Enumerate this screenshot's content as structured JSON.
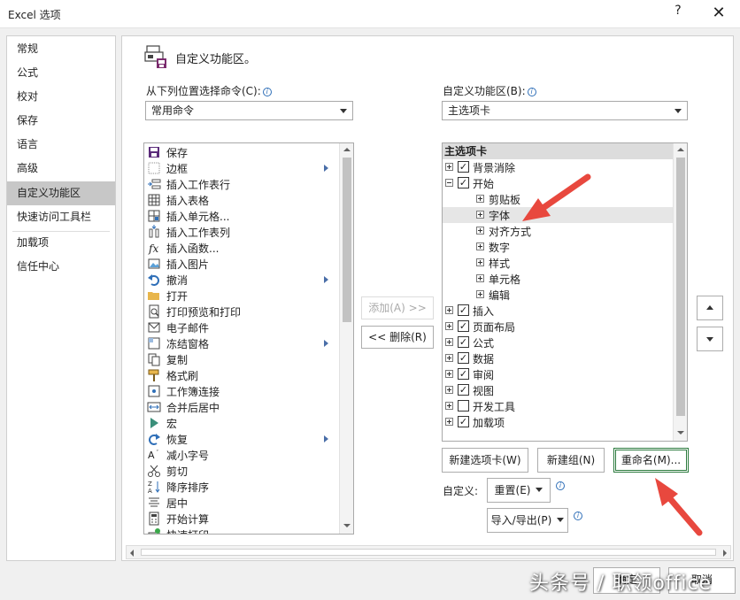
{
  "window": {
    "title": "Excel 选项",
    "help_glyph": "?",
    "close_glyph": "✕"
  },
  "nav": {
    "items": [
      {
        "label": "常规"
      },
      {
        "label": "公式"
      },
      {
        "label": "校对"
      },
      {
        "label": "保存"
      },
      {
        "label": "语言"
      },
      {
        "label": "高级"
      },
      {
        "label": "自定义功能区",
        "selected": true
      },
      {
        "label": "快速访问工具栏"
      },
      {
        "label": "加载项"
      },
      {
        "label": "信任中心"
      }
    ]
  },
  "header": {
    "title": "自定义功能区。"
  },
  "commands": {
    "label": "从下列位置选择命令(C):",
    "source_selected": "常用命令",
    "items": [
      {
        "label": "保存",
        "icon": "save-icon"
      },
      {
        "label": "边框",
        "icon": "border-icon",
        "submenu": true
      },
      {
        "label": "插入工作表行",
        "icon": "insert-row-icon"
      },
      {
        "label": "插入表格",
        "icon": "insert-table-icon"
      },
      {
        "label": "插入单元格...",
        "icon": "insert-cells-icon"
      },
      {
        "label": "插入工作表列",
        "icon": "insert-column-icon"
      },
      {
        "label": "插入函数...",
        "icon": "function-icon"
      },
      {
        "label": "插入图片",
        "icon": "picture-icon"
      },
      {
        "label": "撤消",
        "icon": "undo-icon",
        "submenu": true
      },
      {
        "label": "打开",
        "icon": "open-folder-icon"
      },
      {
        "label": "打印预览和打印",
        "icon": "print-preview-icon"
      },
      {
        "label": "电子邮件",
        "icon": "email-icon"
      },
      {
        "label": "冻结窗格",
        "icon": "freeze-panes-icon",
        "submenu": true
      },
      {
        "label": "复制",
        "icon": "copy-icon"
      },
      {
        "label": "格式刷",
        "icon": "format-painter-icon"
      },
      {
        "label": "工作簿连接",
        "icon": "connections-icon"
      },
      {
        "label": "合并后居中",
        "icon": "merge-center-icon"
      },
      {
        "label": "宏",
        "icon": "macro-icon"
      },
      {
        "label": "恢复",
        "icon": "redo-icon",
        "submenu": true
      },
      {
        "label": "减小字号",
        "icon": "decrease-font-icon"
      },
      {
        "label": "剪切",
        "icon": "cut-icon"
      },
      {
        "label": "降序排序",
        "icon": "sort-descending-icon"
      },
      {
        "label": "居中",
        "icon": "align-center-icon"
      },
      {
        "label": "开始计算",
        "icon": "calculate-icon"
      },
      {
        "label": "快速打印",
        "icon": "quick-print-icon"
      }
    ]
  },
  "ribbon": {
    "label": "自定义功能区(B):",
    "target_selected": "主选项卡",
    "tree_header": "主选项卡",
    "items": [
      {
        "label": "背景消除",
        "level": 0,
        "expander": "plus",
        "checked": true
      },
      {
        "label": "开始",
        "level": 0,
        "expander": "minus",
        "checked": true
      },
      {
        "label": "剪贴板",
        "level": 1,
        "expander": "plus"
      },
      {
        "label": "字体",
        "level": 1,
        "expander": "plus",
        "selected": true
      },
      {
        "label": "对齐方式",
        "level": 1,
        "expander": "plus"
      },
      {
        "label": "数字",
        "level": 1,
        "expander": "plus"
      },
      {
        "label": "样式",
        "level": 1,
        "expander": "plus"
      },
      {
        "label": "单元格",
        "level": 1,
        "expander": "plus"
      },
      {
        "label": "编辑",
        "level": 1,
        "expander": "plus"
      },
      {
        "label": "插入",
        "level": 0,
        "expander": "plus",
        "checked": true
      },
      {
        "label": "页面布局",
        "level": 0,
        "expander": "plus",
        "checked": true
      },
      {
        "label": "公式",
        "level": 0,
        "expander": "plus",
        "checked": true
      },
      {
        "label": "数据",
        "level": 0,
        "expander": "plus",
        "checked": true
      },
      {
        "label": "审阅",
        "level": 0,
        "expander": "plus",
        "checked": true
      },
      {
        "label": "视图",
        "level": 0,
        "expander": "plus",
        "checked": true
      },
      {
        "label": "开发工具",
        "level": 0,
        "expander": "plus",
        "checked": false
      },
      {
        "label": "加载项",
        "level": 0,
        "expander": "plus",
        "checked": true
      }
    ]
  },
  "buttons": {
    "add": "添加(A) >>",
    "remove": "<< 删除(R)",
    "new_tab": "新建选项卡(W)",
    "new_group": "新建组(N)",
    "rename": "重命名(M)...",
    "custom_label": "自定义:",
    "reset": "重置(E)",
    "import_export": "导入/导出(P)",
    "ok": "确定",
    "cancel": "取消"
  },
  "watermark": "头条号 / 职领office",
  "colors": {
    "annotation_arrow": "#e8483e",
    "nav_selected": "#c7c7c7",
    "focus_border": "#2b7a3d"
  }
}
